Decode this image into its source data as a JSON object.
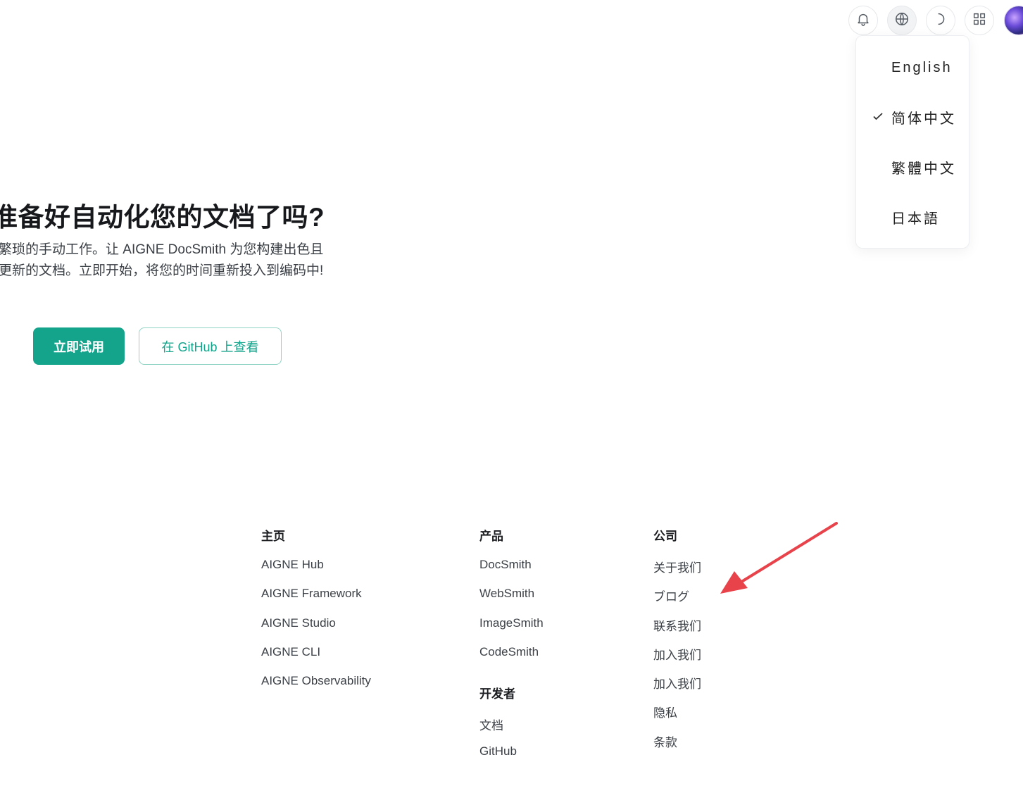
{
  "header": {
    "icons": [
      "bell-icon",
      "globe-icon",
      "moon-icon",
      "apps-icon"
    ]
  },
  "language_menu": {
    "items": [
      {
        "label": "English",
        "selected": false
      },
      {
        "label": "简体中文",
        "selected": true
      },
      {
        "label": "繁體中文",
        "selected": false
      },
      {
        "label": "日本語",
        "selected": false
      }
    ]
  },
  "hero": {
    "title": "准备好自动化您的文档了吗?",
    "description_line1": "繁琐的手动工作。让 AIGNE DocSmith 为您构建出色且",
    "description_line2": "更新的文档。立即开始，将您的时间重新投入到编码中!",
    "primary_button": "立即试用",
    "secondary_button": "在 GitHub 上查看"
  },
  "footer": {
    "home": {
      "heading": "主页",
      "links": [
        "AIGNE Hub",
        "AIGNE Framework",
        "AIGNE Studio",
        "AIGNE CLI",
        "AIGNE Observability"
      ]
    },
    "products": {
      "heading": "产品",
      "links": [
        "DocSmith",
        "WebSmith",
        "ImageSmith",
        "CodeSmith"
      ]
    },
    "developers": {
      "heading": "开发者",
      "links": [
        "文档",
        "GitHub"
      ]
    },
    "company": {
      "heading": "公司",
      "links": [
        "关于我们",
        "ブログ",
        "联系我们",
        "加入我们",
        "加入我们",
        "隐私",
        "条款"
      ]
    }
  },
  "colors": {
    "accent": "#14a38b",
    "annotation_arrow": "#e8434b"
  }
}
